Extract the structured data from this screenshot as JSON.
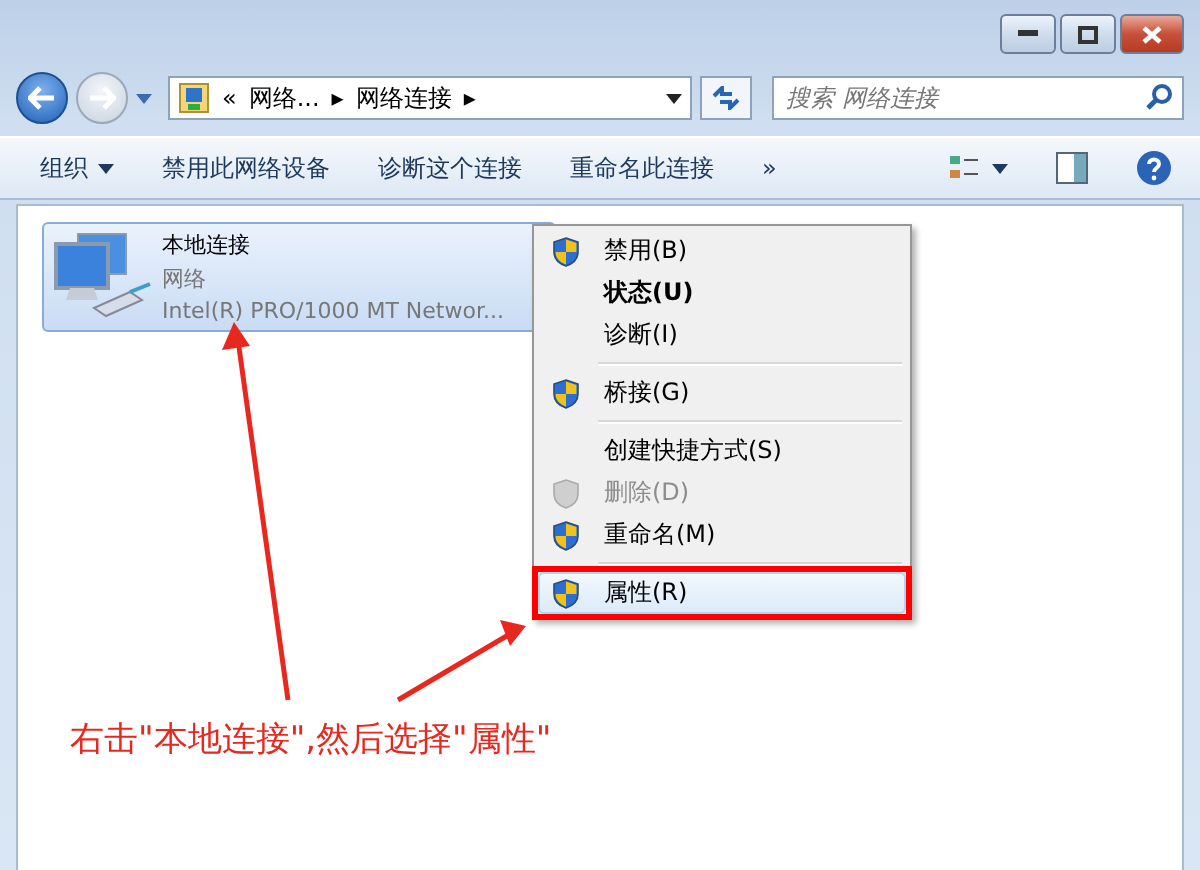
{
  "window": {
    "controls": [
      {
        "kind": "minimize"
      },
      {
        "kind": "maximize"
      },
      {
        "kind": "close"
      }
    ]
  },
  "address": {
    "chevron": "«",
    "crumbs": [
      "网络...",
      "网络连接"
    ],
    "separator": "▸"
  },
  "search": {
    "placeholder": "搜索 网络连接"
  },
  "toolbar": {
    "items": [
      {
        "label": "组织",
        "dropdown": true
      },
      {
        "label": "禁用此网络设备",
        "dropdown": false
      },
      {
        "label": "诊断这个连接",
        "dropdown": false
      },
      {
        "label": "重命名此连接",
        "dropdown": false
      }
    ],
    "more": "»"
  },
  "connection": {
    "name": "本地连接",
    "network": "网络",
    "adapter": "Intel(R) PRO/1000 MT Networ...",
    "selected": true
  },
  "menu": [
    {
      "kind": "item",
      "label": "禁用(B)",
      "shield": true,
      "bold": false,
      "disabled": false,
      "selected": false
    },
    {
      "kind": "item",
      "label": "状态(U)",
      "shield": false,
      "bold": true,
      "disabled": false,
      "selected": false
    },
    {
      "kind": "item",
      "label": "诊断(I)",
      "shield": false,
      "bold": false,
      "disabled": false,
      "selected": false
    },
    {
      "kind": "separator"
    },
    {
      "kind": "item",
      "label": "桥接(G)",
      "shield": true,
      "bold": false,
      "disabled": false,
      "selected": false
    },
    {
      "kind": "separator"
    },
    {
      "kind": "item",
      "label": "创建快捷方式(S)",
      "shield": false,
      "bold": false,
      "disabled": false,
      "selected": false
    },
    {
      "kind": "item",
      "label": "删除(D)",
      "shield": true,
      "bold": false,
      "disabled": true,
      "selected": false
    },
    {
      "kind": "item",
      "label": "重命名(M)",
      "shield": true,
      "bold": false,
      "disabled": false,
      "selected": false
    },
    {
      "kind": "separator"
    },
    {
      "kind": "item",
      "label": "属性(R)",
      "shield": true,
      "bold": false,
      "disabled": false,
      "selected": true
    }
  ],
  "annotation": {
    "text": "右击\"本地连接\",然后选择\"属性\""
  }
}
